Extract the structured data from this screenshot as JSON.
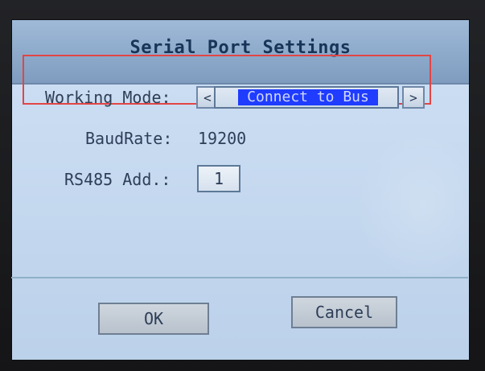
{
  "dialog": {
    "title": "Serial Port Settings"
  },
  "working_mode": {
    "label": "Working Mode:",
    "prev_symbol": "<",
    "value": "Connect to Bus",
    "next_symbol": ">"
  },
  "baud_rate": {
    "label": "BaudRate:",
    "value": "19200"
  },
  "rs485": {
    "label": "RS485 Add.:",
    "value": "1"
  },
  "buttons": {
    "ok_label": "OK",
    "cancel_label": "Cancel"
  },
  "colors": {
    "highlight_border": "#e24545",
    "selection_bg": "#1f3cff",
    "title_bar": "#8ea9c8",
    "screen_bg": "#c8dbf1"
  },
  "icons": {
    "prev": "chevron-left-icon",
    "next": "chevron-right-icon"
  }
}
